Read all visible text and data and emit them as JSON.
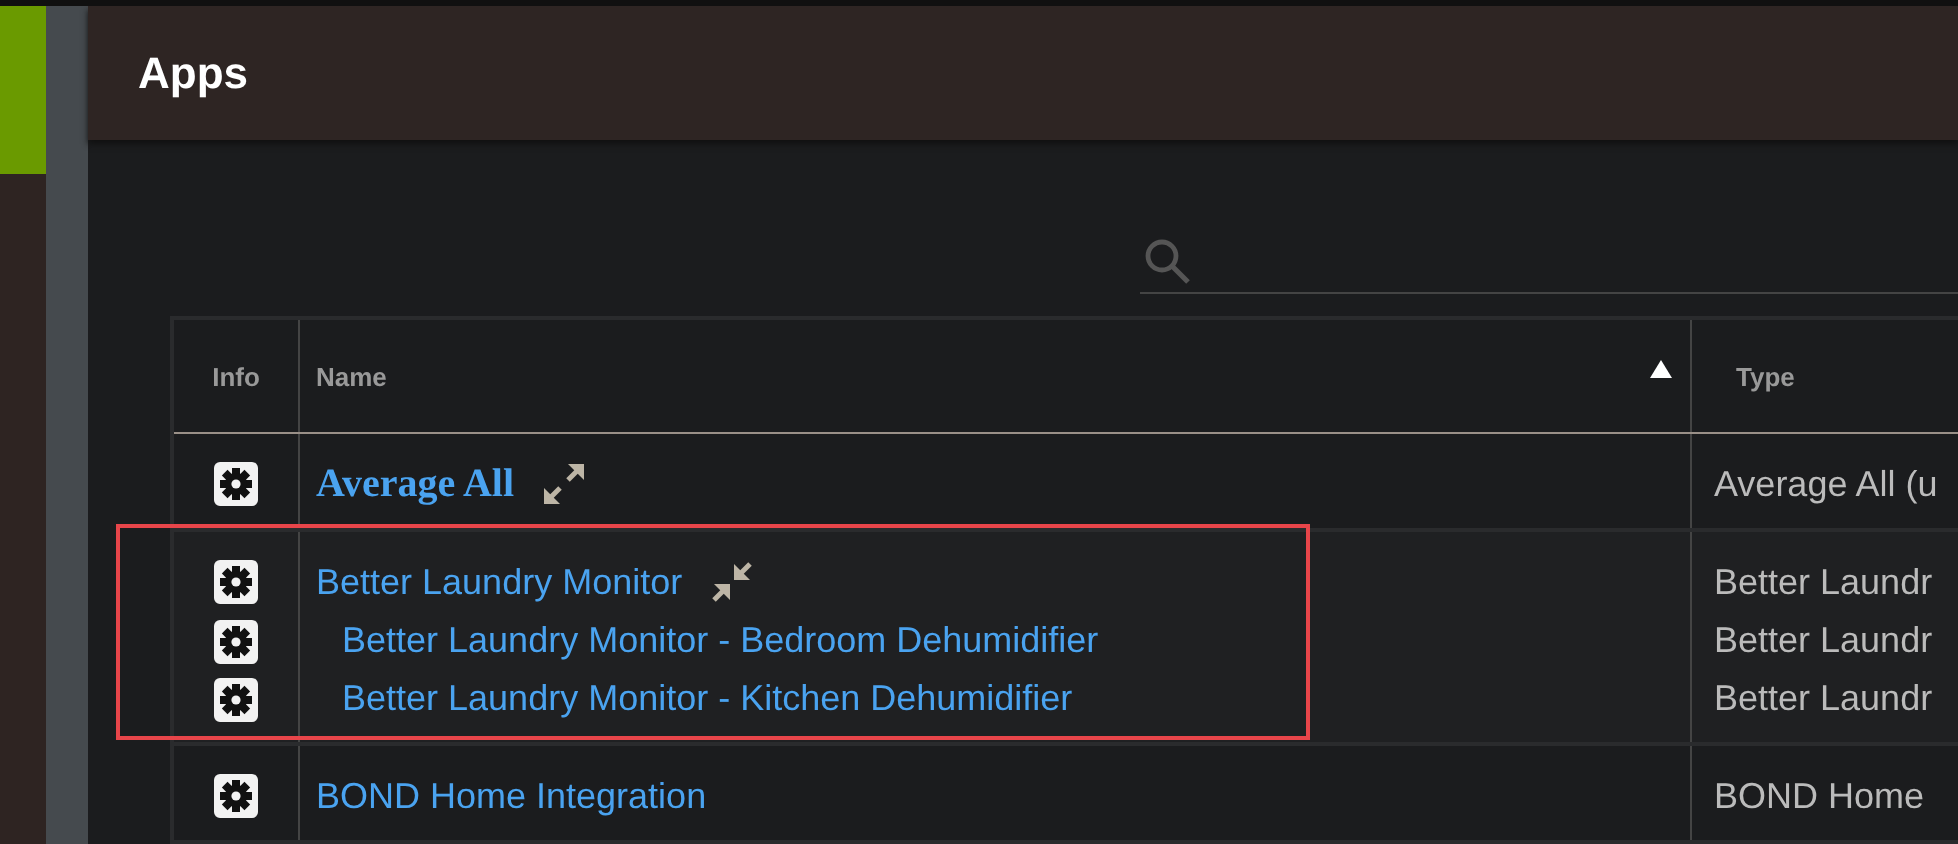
{
  "page": {
    "title": "Apps"
  },
  "table": {
    "columns": [
      {
        "label": "Info",
        "sorted": false
      },
      {
        "label": "Name",
        "sorted": true
      },
      {
        "label": "Type",
        "sorted": false
      }
    ],
    "rows": [
      {
        "name": "Average All",
        "type": "Average All (u",
        "expanded": false,
        "highlighted": false,
        "children": []
      },
      {
        "name": "Better Laundry Monitor",
        "type": "Better Laundr",
        "expanded": true,
        "highlighted": true,
        "children": [
          {
            "name": "Better Laundry Monitor - Bedroom Dehumidifier",
            "type": "Better Laundr"
          },
          {
            "name": "Better Laundry Monitor - Kitchen Dehumidifier",
            "type": "Better Laundr"
          }
        ]
      },
      {
        "name": "BOND Home Integration",
        "type": "BOND Home",
        "highlighted": false,
        "children": []
      }
    ]
  }
}
